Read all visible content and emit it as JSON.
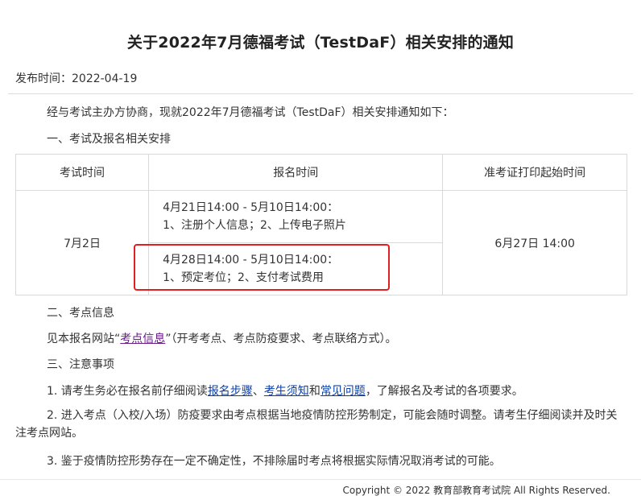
{
  "article": {
    "title": "关于2022年7月德福考试（TestDaF）相关安排的通知",
    "pubdate": "发布时间：2022-04-19",
    "intro": "经与考试主办方协商，现就2022年7月德福考试（TestDaF）相关安排通知如下：",
    "section1": "一、考试及报名相关安排",
    "table": {
      "headers": [
        "考试时间",
        "报名时间",
        "准考证打印起始时间"
      ],
      "exam_date": "7月2日",
      "periods": [
        {
          "range": "4月21日14:00 - 5月10日14:00：",
          "tasks": "1、注册个人信息；2、上传电子照片"
        },
        {
          "range": "4月28日14:00 - 5月10日14:00：",
          "tasks": "1、预定考位；2、支付考试费用"
        }
      ],
      "admit_print": "6月27日 14:00"
    },
    "section2": "二、考点信息",
    "site_text_before": "见本报名网站“",
    "site_link": "考点信息",
    "site_text_after": "”（开考考点、考点防疫要求、考点联络方式）。",
    "section3": "三、注意事项",
    "note1_before": "1. 请考生务必在报名前仔细阅读",
    "note1_link1": "报名步骤",
    "note1_sep": "、",
    "note1_link2": "考生须知",
    "note1_and": "和",
    "note1_link3": "常见问题",
    "note1_after": "，了解报名及考试的各项要求。",
    "note2": "2. 进入考点（入校/入场）防疫要求由考点根据当地疫情防控形势制定，可能会随时调整。请考生仔细阅读并及时关注考点网站。",
    "note3": "3. 鉴于疫情防控形势存在一定不确定性，不排除届时考点将根据实际情况取消考试的可能。"
  },
  "footer": {
    "copyright": "Copyright © 2022 教育部教育考试院 All Rights Reserved."
  },
  "colors": {
    "highlight": "#e02020",
    "link": "#0a3ea8",
    "visited_link": "#6a1b8a"
  }
}
